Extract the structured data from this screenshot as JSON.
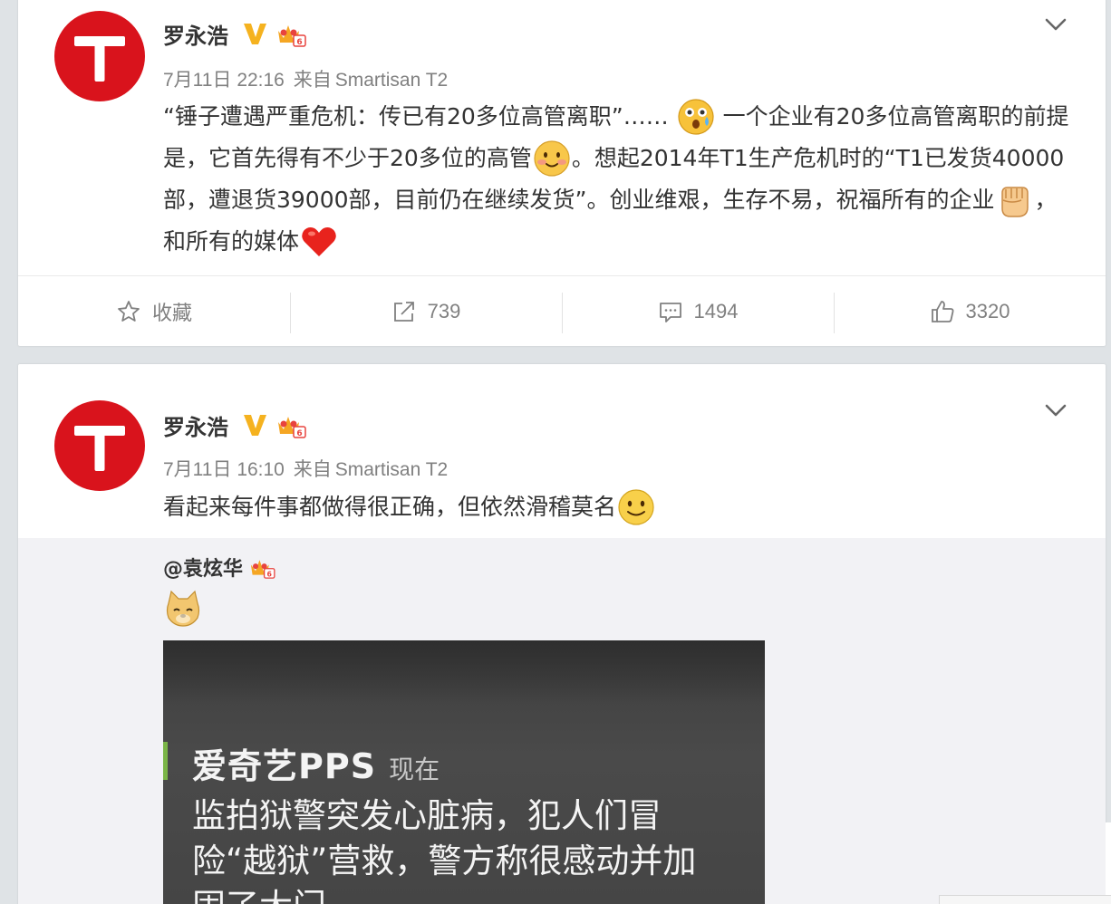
{
  "posts": [
    {
      "author": "罗永浩",
      "timestamp": "7月11日 22:16",
      "source_prefix": "来自",
      "source": "Smartisan T2",
      "text_segments": [
        "“锤子遭遇严重危机：传已有20多位高管离职”……",
        "一个企业有20多位高管离职的前提是，它首先得有不少于20多位的高管",
        "。想起2014年T1生产危机时的“T1已发货40000部，遭退货39000部，目前仍在继续发货”。创业维艰，生存不易，祝福所有的企业",
        "，和所有的媒体"
      ],
      "emojis": [
        "shocked-sweat-emoji",
        "blush-smile-emoji",
        "fist-emoji",
        "heart-emoji"
      ],
      "actions": {
        "favorite_label": "收藏",
        "repost_count": "739",
        "comment_count": "1494",
        "like_count": "3320"
      }
    },
    {
      "author": "罗永浩",
      "timestamp": "7月11日 16:10",
      "source_prefix": "来自",
      "source": "Smartisan T2",
      "text": "看起来每件事都做得很正确，但依然滑稽莫名",
      "emojis": [
        "smile-emoji"
      ],
      "repost": {
        "user": "@袁炫华",
        "emoji": "doge-emoji",
        "image": {
          "app_name": "爱奇艺PPS",
          "time": "现在",
          "body_lines": [
            "监拍狱警突发心脏病，犯人们冒",
            "险“越狱”营救，警方称很感动并加",
            "固了大门。"
          ]
        }
      }
    }
  ],
  "icons": {
    "verified": "verified-v-icon",
    "membership": "crown-member-icon",
    "menu": "chevron-down-icon",
    "favorite": "star-outline-icon",
    "repost": "share-arrow-icon",
    "comment": "comment-bubble-icon",
    "like": "thumbs-up-icon"
  },
  "colors": {
    "avatar_red": "#d9131c",
    "verified_gold": "#f5b21f",
    "background": "#dfe3e6",
    "meta_gray": "#808080"
  }
}
